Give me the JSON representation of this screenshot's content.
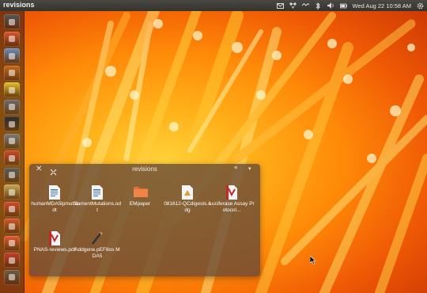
{
  "panel": {
    "app_title": "revisions",
    "clock": "Wed Aug 22 10:58 AM",
    "indicators": [
      "mail-icon",
      "dropbox-icon",
      "network-icon",
      "bluetooth-icon",
      "volume-icon",
      "battery-icon",
      "power-gear-icon"
    ]
  },
  "launcher": {
    "items": [
      {
        "icon": "dash-home-icon",
        "color": "#555"
      },
      {
        "icon": "files-folder-icon",
        "color": "#d9572d"
      },
      {
        "icon": "chromium-browser-icon",
        "color": "#6a8fbf"
      },
      {
        "icon": "firefox-icon",
        "color": "#c66a1e"
      },
      {
        "icon": "eye-of-gnome-icon",
        "color": "#e3c02c"
      },
      {
        "icon": "text-editor-icon",
        "color": "#6b6b6b"
      },
      {
        "icon": "terminal-icon",
        "color": "#2d2d2d"
      },
      {
        "icon": "system-settings-icon",
        "color": "#7a7a7a"
      },
      {
        "icon": "document-viewer-icon",
        "color": "#c94a2b"
      },
      {
        "icon": "calculator-icon",
        "color": "#5b5b5b"
      },
      {
        "icon": "image-viewer-icon",
        "color": "#c8a95a"
      },
      {
        "icon": "pdf-reader-icon",
        "color": "#d24a2a"
      },
      {
        "icon": "presentation-icon",
        "color": "#d0582a"
      },
      {
        "icon": "ubuntu-one-icon",
        "color": "#e25a30"
      },
      {
        "icon": "software-center-icon",
        "color": "#c2402a"
      },
      {
        "icon": "workspace-switcher-icon",
        "color": "#6b5b4b"
      }
    ]
  },
  "window": {
    "title": "revisions",
    "files": [
      {
        "name": "humanMDA5lpmut.odt",
        "type": "odt-document-icon"
      },
      {
        "name": "filamentMutations.odt",
        "type": "odt-document-icon"
      },
      {
        "name": "EMpaper",
        "type": "folder-icon"
      },
      {
        "name": "081612-QCdigests.odg",
        "type": "odg-drawing-icon"
      },
      {
        "name": "Luciferase Assay Protocol...",
        "type": "pdf-document-icon"
      },
      {
        "name": "PNAS-reviews.pdf",
        "type": "pdf-document-icon"
      },
      {
        "name": "Addgene.pEF8os MDA5",
        "type": "sequence-file-icon"
      }
    ]
  }
}
